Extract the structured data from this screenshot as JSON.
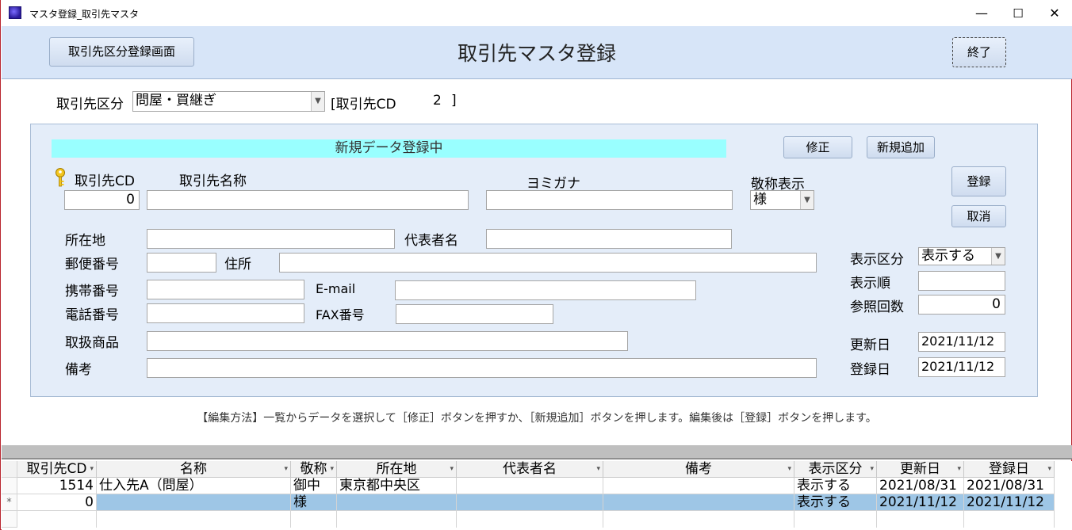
{
  "window": {
    "title": "マスタ登録_取引先マスタ",
    "minimize": "—",
    "maximize": "☐",
    "close": "✕"
  },
  "header": {
    "nav_button": "取引先区分登録画面",
    "title": "取引先マスタ登録",
    "exit_button": "終了"
  },
  "filter": {
    "kubun_label": "取引先区分",
    "kubun_value": "問屋・買継ぎ",
    "cd_label": "[取引先CD",
    "cd_value": "2",
    "cd_close": "]"
  },
  "panel": {
    "status": "新規データ登録中",
    "edit_button": "修正",
    "add_button": "新規追加",
    "register_button": "登録",
    "cancel_button": "取消",
    "labels": {
      "cd": "取引先CD",
      "name": "取引先名称",
      "yomi": "ヨミガナ",
      "keisho": "敬称表示",
      "location": "所在地",
      "rep": "代表者名",
      "zip": "郵便番号",
      "address": "住所",
      "mobile": "携帯番号",
      "email": "E-mail",
      "phone": "電話番号",
      "fax": "FAX番号",
      "products": "取扱商品",
      "note": "備考",
      "display_kubun": "表示区分",
      "display_order": "表示順",
      "ref_count": "参照回数",
      "updated": "更新日",
      "registered": "登録日"
    },
    "values": {
      "cd": "0",
      "name": "",
      "yomi": "",
      "keisho": "様",
      "location": "",
      "rep": "",
      "zip": "",
      "address": "",
      "mobile": "",
      "email": "",
      "phone": "",
      "fax": "",
      "products": "",
      "note": "",
      "display_kubun": "表示する",
      "display_order": "",
      "ref_count": "0",
      "updated": "2021/11/12",
      "registered": "2021/11/12"
    }
  },
  "hint": "【編集方法】一覧からデータを選択して［修正］ボタンを押すか、［新規追加］ボタンを押します。編集後は［登録］ボタンを押します。",
  "grid": {
    "columns": [
      "取引先CD",
      "名称",
      "敬称",
      "所在地",
      "代表者名",
      "備考",
      "表示区分",
      "更新日",
      "登録日"
    ],
    "rows": [
      {
        "marker": "",
        "cells": [
          "1514",
          "仕入先A（問屋）",
          "御中",
          "東京都中央区",
          "",
          "",
          "表示する",
          "2021/08/31",
          "2021/08/31"
        ]
      },
      {
        "marker": "*",
        "cells": [
          "0",
          "",
          "様",
          "",
          "",
          "",
          "表示する",
          "2021/11/12",
          "2021/11/12"
        ]
      }
    ]
  },
  "icons": {
    "key": "key-icon",
    "app": "app-icon",
    "dropdown": "chevron-down-icon",
    "sort": "sort-arrow-icon"
  }
}
